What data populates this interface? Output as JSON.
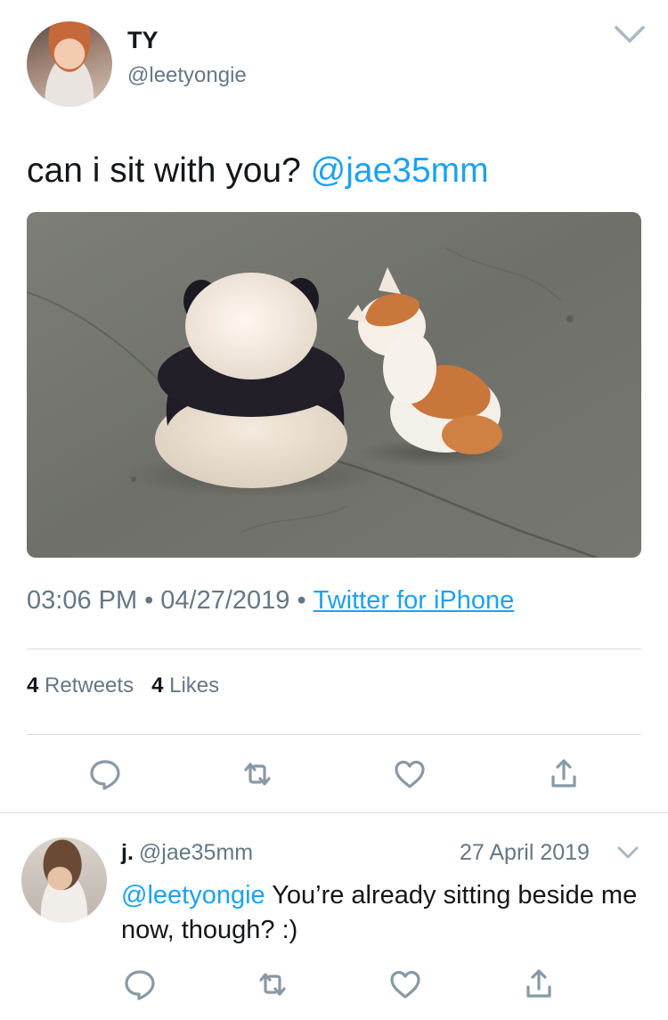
{
  "tweet": {
    "author_name": "TY",
    "author_handle": "@leetyongie",
    "text": "can i sit with you?",
    "mention": "@jae35mm",
    "time": "03:06 PM",
    "date": "04/27/2019",
    "source": "Twitter for iPhone",
    "retweet_count": "4",
    "retweet_label": "Retweets",
    "like_count": "4",
    "like_label": "Likes"
  },
  "reply": {
    "author_name": "j.",
    "author_handle": "@jae35mm",
    "date": "27 April 2019",
    "mention": "@leetyongie",
    "text": "You’re already sitting beside me now, though? :)"
  },
  "icons": {
    "reply": "reply-icon",
    "retweet": "retweet-icon",
    "like": "heart-icon",
    "share": "share-icon",
    "menu": "chevron-down-icon"
  },
  "colors": {
    "accent": "#1da1f2",
    "secondary_text": "#657786",
    "icon_gray": "#8899a6",
    "divider": "#d6dbe0"
  }
}
